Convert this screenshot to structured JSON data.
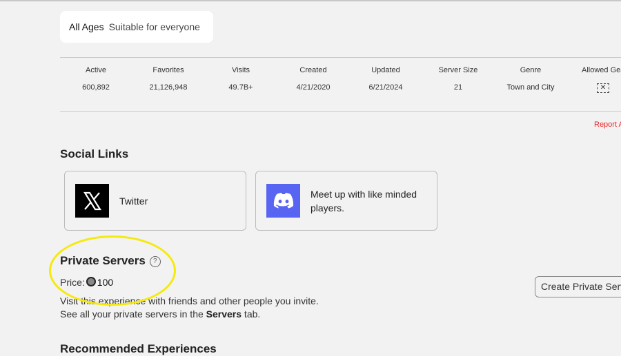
{
  "age_rating": {
    "label": "All Ages",
    "description": "Suitable for everyone"
  },
  "stats": [
    {
      "label": "Active",
      "value": "600,892"
    },
    {
      "label": "Favorites",
      "value": "21,126,948"
    },
    {
      "label": "Visits",
      "value": "49.7B+"
    },
    {
      "label": "Created",
      "value": "4/21/2020"
    },
    {
      "label": "Updated",
      "value": "6/21/2024"
    },
    {
      "label": "Server Size",
      "value": "21"
    },
    {
      "label": "Genre",
      "value": "Town and City"
    },
    {
      "label": "Allowed Gea",
      "icon": "gear-not-allowed-icon"
    }
  ],
  "report_link": "Report A",
  "social": {
    "title": "Social Links",
    "links": [
      {
        "label": "Twitter",
        "icon": "x-logo-icon"
      },
      {
        "label": "Meet up with like minded players.",
        "icon": "discord-logo-icon"
      }
    ]
  },
  "private_servers": {
    "title": "Private Servers",
    "price_label": "Price:",
    "price": "100",
    "desc1": "Visit this experience with friends and other people you invite.",
    "desc2_pre": "See all your private servers in the ",
    "desc2_bold": "Servers",
    "desc2_post": " tab.",
    "create_button": "Create Private Serv"
  },
  "recommended_title": "Recommended Experiences",
  "colors": {
    "highlight": "#f5e90e",
    "report": "#ee2222",
    "discord": "#5865f2"
  }
}
